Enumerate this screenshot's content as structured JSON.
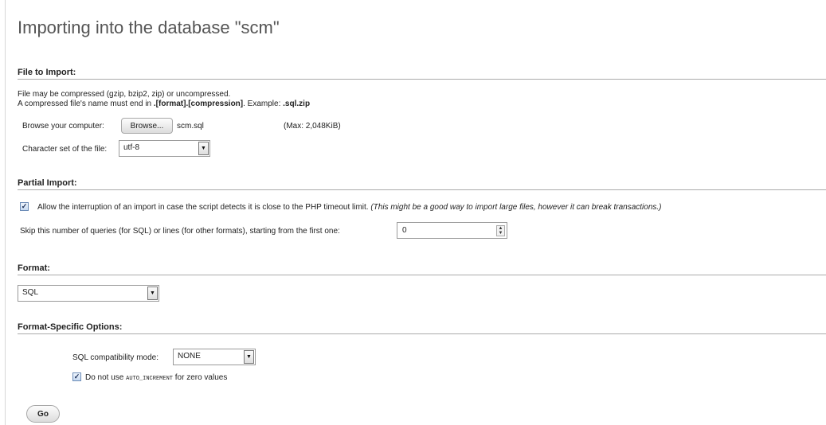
{
  "page": {
    "title": "Importing into the database \"scm\""
  },
  "file_to_import": {
    "header": "File to Import:",
    "line1": "File may be compressed (gzip, bzip2, zip) or uncompressed.",
    "line2_prefix": "A compressed file's name must end in ",
    "line2_pattern": ".[format].[compression]",
    "line2_mid": ". Example: ",
    "line2_example": ".sql.zip",
    "browse_label": "Browse your computer:",
    "browse_button": "Browse...",
    "selected_file": "scm.sql",
    "max_size": "(Max: 2,048KiB)",
    "charset_label": "Character set of the file:",
    "charset_value": "utf-8"
  },
  "partial_import": {
    "header": "Partial Import:",
    "allow_interrupt_checked": true,
    "allow_interrupt_label": "Allow the interruption of an import in case the script detects it is close to the PHP timeout limit.",
    "allow_interrupt_note": "(This might be a good way to import large files, however it can break transactions.)",
    "skip_label": "Skip this number of queries (for SQL) or lines (for other formats), starting from the first one:",
    "skip_value": "0"
  },
  "format": {
    "header": "Format:",
    "value": "SQL"
  },
  "format_options": {
    "header": "Format-Specific Options:",
    "compat_label": "SQL compatibility mode:",
    "compat_value": "NONE",
    "no_auto_inc_checked": true,
    "no_auto_inc_prefix": "Do not use ",
    "no_auto_inc_code": "AUTO_INCREMENT",
    "no_auto_inc_suffix": " for zero values"
  },
  "actions": {
    "go_label": "Go"
  },
  "icons": {
    "check": "✓",
    "arrow_down": "▼",
    "spin_up": "▲",
    "spin_down": "▼"
  }
}
